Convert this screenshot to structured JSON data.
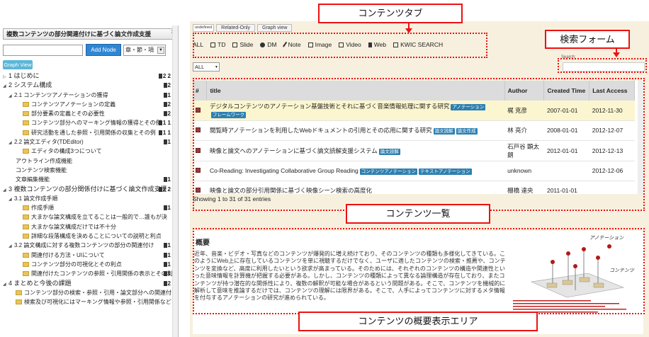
{
  "callouts": {
    "content_tab": "コンテンツタブ",
    "search_form": "検索フォーム",
    "content_list": "コンテンツ一覧",
    "summary_area": "コンテンツの概要表示エリア"
  },
  "left": {
    "project_title": "複数コンテンツの部分関連付けに基づく論文作成支援",
    "close": "×",
    "node_placeholder": "",
    "add_node_label": "Add Node",
    "level_select": "章・節・項",
    "graph_view_label": "Graph View",
    "tree": [
      {
        "level": 0,
        "arrow": "▷",
        "label": "1 はじめに",
        "folder": false,
        "badges": "2  2"
      },
      {
        "level": 0,
        "arrow": "◢",
        "label": "2 システム構成",
        "folder": false,
        "badges": "2"
      },
      {
        "level": 1,
        "arrow": "◢",
        "label": "2.1 コンテンツアノテーションの獲得",
        "folder": false,
        "badges": "1"
      },
      {
        "level": 3,
        "arrow": "",
        "label": "コンテンツアノテーションの定義",
        "folder": true,
        "badges": "2"
      },
      {
        "level": 3,
        "arrow": "",
        "label": "部分要素の定義とその必要性",
        "folder": true,
        "badges": "2"
      },
      {
        "level": 3,
        "arrow": "",
        "label": "コンテンツ部分へのマーキング情報の獲得とその例",
        "folder": true,
        "badges": "1  1"
      },
      {
        "level": 3,
        "arrow": "",
        "label": "研究活動を通した参照・引用関係の収集とその例",
        "folder": true,
        "badges": "1  1"
      },
      {
        "level": 1,
        "arrow": "◢",
        "label": "2.2 論文エディタ(TDEditor)",
        "folder": false,
        "badges": "1"
      },
      {
        "level": 3,
        "arrow": "",
        "label": "エディタの構成3つについて",
        "folder": true,
        "badges": ""
      },
      {
        "level": 2,
        "arrow": "",
        "label": "アウトライン作成機能",
        "folder": false,
        "badges": ""
      },
      {
        "level": 2,
        "arrow": "",
        "label": "コンテンツ検索機能",
        "folder": false,
        "badges": ""
      },
      {
        "level": 2,
        "arrow": "",
        "label": "文章編集機能",
        "folder": false,
        "badges": "1"
      },
      {
        "level": 0,
        "arrow": "◢",
        "label": "3 複数コンテンツの部分関係付けに基づく論文作成支援",
        "folder": false,
        "badges": "2  2"
      },
      {
        "level": 1,
        "arrow": "◢",
        "label": "3.1 論文作成手順",
        "folder": false,
        "badges": ""
      },
      {
        "level": 3,
        "arrow": "",
        "label": "作成手順",
        "folder": true,
        "badges": "1"
      },
      {
        "level": 3,
        "arrow": "",
        "label": "大まかな論文構成を立てることは一般的で…誰もが決",
        "folder": true,
        "badges": ""
      },
      {
        "level": 3,
        "arrow": "",
        "label": "大まかな論文構成だけでは不十分",
        "folder": true,
        "badges": ""
      },
      {
        "level": 3,
        "arrow": "",
        "label": "詳細な段落構成を決めることについての説明と利点",
        "folder": true,
        "badges": ""
      },
      {
        "level": 1,
        "arrow": "◢",
        "label": "3.2 論文構成に対する複数コンテンツの部分の関連付け",
        "folder": false,
        "badges": "1"
      },
      {
        "level": 3,
        "arrow": "",
        "label": "関連付ける方法・UIについて",
        "folder": true,
        "badges": "1"
      },
      {
        "level": 3,
        "arrow": "",
        "label": "コンテンツ部分の可視化とその利点",
        "folder": true,
        "badges": "1"
      },
      {
        "level": 3,
        "arrow": "",
        "label": "関連付けたコンテンツの参照・引用関係の表示とその利点",
        "folder": true,
        "badges": "1"
      },
      {
        "level": 0,
        "arrow": "◢",
        "label": "4 まとめと今後の課題",
        "folder": false,
        "badges": "2"
      },
      {
        "level": 2,
        "arrow": "",
        "label": "コンテンツ部分の検索・参照・引用・論文部分への関連付け",
        "folder": true,
        "badges": ""
      },
      {
        "level": 2,
        "arrow": "",
        "label": "検索及び可視化にはマーキング情報や参照・引用関係など",
        "folder": true,
        "badges": ""
      }
    ]
  },
  "top_tabs": [
    {
      "label": "undefined",
      "active": true
    },
    {
      "label": "Related-Only",
      "active": false
    },
    {
      "label": "Graph view",
      "active": false
    }
  ],
  "content_tabs": [
    {
      "label": "ALL",
      "icon": "none"
    },
    {
      "label": "TD",
      "icon": "box"
    },
    {
      "label": "Slide",
      "icon": "box"
    },
    {
      "label": "DM",
      "icon": "dot"
    },
    {
      "label": "Note",
      "icon": "pen"
    },
    {
      "label": "Image",
      "icon": "box"
    },
    {
      "label": "Video",
      "icon": "box"
    },
    {
      "label": "Web",
      "icon": "flag"
    },
    {
      "label": "KWIC SEARCH",
      "icon": "box"
    }
  ],
  "filter_select": "ALL",
  "search_label": "Search:",
  "table": {
    "headers": [
      "#",
      "title",
      "Author",
      "Created Time",
      "Last Access"
    ],
    "rows": [
      {
        "title": "デジタルコンテンツのアノテーション基盤技術とそれに基づく音楽情報処理に関する研究",
        "tags": [
          "アノテーション",
          "フレームワーク"
        ],
        "author": "梶 克彦",
        "created": "2007-01-01",
        "last": "2012-11-30",
        "highlight": true
      },
      {
        "title": "閲覧時アノテーションを利用したWebドキュメントの引用とその応用に関する研究",
        "tags": [
          "論文読解",
          "論文作成"
        ],
        "author": "林 亮介",
        "created": "2008-01-01",
        "last": "2012-12-07",
        "highlight": false
      },
      {
        "title": "映像と論文へのアノテーションに基づく論文読解支援システム",
        "tags": [
          "論文読解"
        ],
        "author": "石戸谷 顕太朗",
        "created": "2012-01-01",
        "last": "2012-12-13",
        "highlight": false
      },
      {
        "title": "Co-Reading: Investigating Collaborative Group Reading",
        "tags": [
          "コンテンツアノテーション",
          "テキストアノテーション"
        ],
        "author": "unknown",
        "created": "",
        "last": "2012-12-06",
        "highlight": false
      },
      {
        "title": "映像と論文の部分引用関係に基づく映像シーン検索の高度化",
        "tags": [],
        "author": "棚橋 達央",
        "created": "2011-01-01",
        "last": "",
        "highlight": false
      }
    ]
  },
  "showing": "Showing 1 to 31 of 31 entries",
  "summary": {
    "heading": "概要",
    "text": "近年、音楽・ビデオ・写真などのコンテンツが爆発的に増え続けており、そのコンテンツの種類も多様化してきている。このようにWeb上に存在しているコンテンツを単に視聴するだけでなく、ユーザに適したコンテンツの検索・推薦や、コンテンツを変換など、高度に利用したいという欲求が高まっている。そのためには、それぞれのコンテンツの構造や関連性といった意味情報を計算機が把握する必要がある。しかし、コンテンツの種類によって異なる論理構造が存在しており、またコンテンツが持つ潜在的な関係性により、複数の解釈が可能な場合があるという問題がある。そこで、コンテンツを機械的に解析して意味を推論するだけでは、コンテンツの理解には限界がある。そこで、人手によってコンテンツに対するメタ情報を付与するアノテーションの研究が進められている。",
    "figure_labels": [
      "アノテーション",
      "コンテンツ"
    ]
  }
}
